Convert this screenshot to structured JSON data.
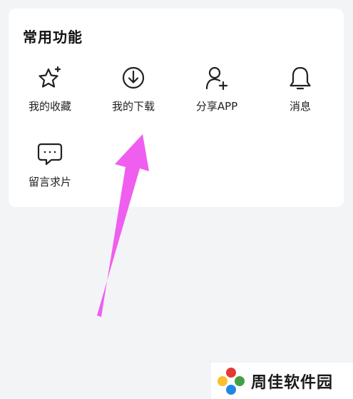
{
  "section": {
    "title": "常用功能"
  },
  "functions": [
    {
      "label": "我的收藏",
      "icon": "star-sparkle-icon"
    },
    {
      "label": "我的下载",
      "icon": "download-icon"
    },
    {
      "label": "分享APP",
      "icon": "add-user-icon"
    },
    {
      "label": "消息",
      "icon": "bell-icon"
    },
    {
      "label": "留言求片",
      "icon": "chat-bubble-icon"
    }
  ],
  "annotation": {
    "arrow_color": "#ee55ee",
    "points_to": "我的下载"
  },
  "watermark": {
    "text": "周佳软件园",
    "logo": "pinwheel-logo"
  },
  "colors": {
    "background": "#f3f4f6",
    "card": "#ffffff",
    "icon_stroke": "#222222"
  }
}
